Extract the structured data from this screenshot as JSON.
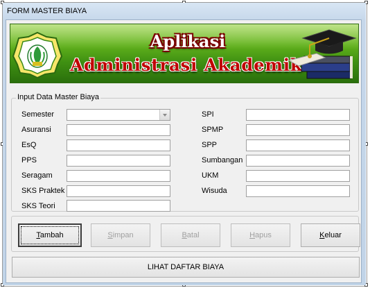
{
  "window": {
    "title": "FORM MASTER BIAYA"
  },
  "banner": {
    "title": "Aplikasi",
    "subtitle": "Administrasi Akademik",
    "logo_icon": "university-crest-icon",
    "art_icon": "graduation-cap-books-icon"
  },
  "form": {
    "group_title": "Input Data Master Biaya",
    "left_fields": [
      {
        "label": "Semester",
        "value": "",
        "type": "combo"
      },
      {
        "label": "Asuransi",
        "value": ""
      },
      {
        "label": "EsQ",
        "value": ""
      },
      {
        "label": "PPS",
        "value": ""
      },
      {
        "label": "Seragam",
        "value": ""
      },
      {
        "label": "SKS Praktek",
        "value": ""
      },
      {
        "label": "SKS Teori",
        "value": ""
      }
    ],
    "right_fields": [
      {
        "label": "SPI",
        "value": ""
      },
      {
        "label": "SPMP",
        "value": ""
      },
      {
        "label": "SPP",
        "value": ""
      },
      {
        "label": "Sumbangan",
        "value": ""
      },
      {
        "label": "UKM",
        "value": ""
      },
      {
        "label": "Wisuda",
        "value": ""
      }
    ]
  },
  "buttons": {
    "tambah": {
      "mnemonic": "T",
      "rest": "ambah"
    },
    "simpan": {
      "mnemonic": "S",
      "rest": "impan"
    },
    "batal": {
      "mnemonic": "B",
      "rest": "atal"
    },
    "hapus": {
      "mnemonic": "H",
      "rest": "apus"
    },
    "keluar": {
      "mnemonic": "K",
      "rest": "eluar"
    },
    "lihat_daftar": "LIHAT DAFTAR BIAYA"
  },
  "colors": {
    "banner_green": "#3f9012",
    "title_red": "#c00000",
    "window_frame": "#c6d7ea"
  }
}
